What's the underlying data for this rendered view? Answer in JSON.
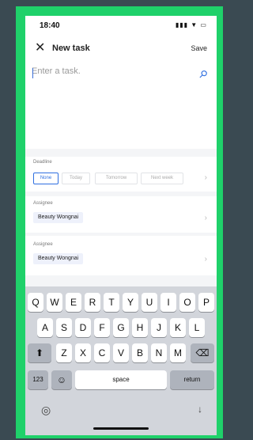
{
  "status": {
    "time": "18:40",
    "icons": "▮▮▮ ▼ ▭"
  },
  "header": {
    "close_icon": "close-icon",
    "title": "New task",
    "save_label": "Save"
  },
  "task": {
    "placeholder": "Enter a task.",
    "attach_icon": "paperclip-icon"
  },
  "deadline": {
    "label": "Deadline",
    "options": [
      "None",
      "Today",
      "Tomorrow",
      "Next week"
    ],
    "selected": "None"
  },
  "assignees": [
    {
      "label": "Assignee",
      "name": "Beauty Wongnai"
    },
    {
      "label": "Assignee",
      "name": "Beauty Wongnai"
    }
  ],
  "keyboard": {
    "row1": [
      "Q",
      "W",
      "E",
      "R",
      "T",
      "Y",
      "U",
      "I",
      "O",
      "P"
    ],
    "row2": [
      "A",
      "S",
      "D",
      "F",
      "G",
      "H",
      "J",
      "K",
      "L"
    ],
    "row3": [
      "Z",
      "X",
      "C",
      "V",
      "B",
      "N",
      "M"
    ],
    "shift": "⬆",
    "backspace": "⌫",
    "numbers": "123",
    "emoji": "☺",
    "space": "space",
    "return": "return",
    "globe": "◎",
    "mic": "↓"
  },
  "colors": {
    "accent": "#2f6fe0",
    "frame": "#1fd16a"
  }
}
